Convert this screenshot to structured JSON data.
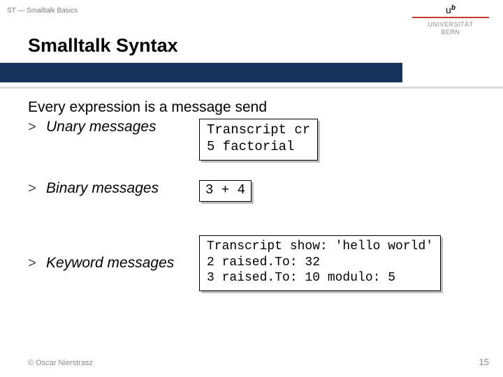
{
  "header": {
    "crumb": "ST — Smalltalk Basics",
    "title": "Smalltalk Syntax"
  },
  "logo": {
    "mark_prefix": "u",
    "mark_b": "b",
    "line1": "UNIVERSITÄT",
    "line2": "BERN"
  },
  "content": {
    "lead": "Every expression is a message send",
    "items": [
      {
        "label": "Unary messages",
        "code": "Transcript cr\n5 factorial"
      },
      {
        "label": "Binary messages",
        "code": "3 + 4"
      },
      {
        "label": "Keyword messages",
        "code": "Transcript show: 'hello world'\n2 raised.To: 32\n3 raised.To: 10 modulo: 5"
      }
    ],
    "bullet_glyph": ">"
  },
  "footer": {
    "copyright": "© Oscar Nierstrasz",
    "page": "15"
  }
}
